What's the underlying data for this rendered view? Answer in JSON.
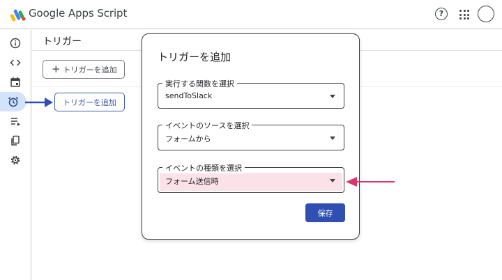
{
  "app": {
    "title": "Google Apps Script"
  },
  "header": {
    "help_glyph": "?",
    "icons": [
      "help-icon",
      "apps-grid-icon",
      "account-avatar"
    ]
  },
  "sidebar": {
    "items": [
      {
        "icon": "info-icon"
      },
      {
        "icon": "code-icon"
      },
      {
        "icon": "calendar-icon"
      },
      {
        "icon": "alarm-clock-icon",
        "active": true
      },
      {
        "icon": "playlist-icon"
      },
      {
        "icon": "copy-icon"
      },
      {
        "icon": "gear-icon"
      }
    ]
  },
  "page": {
    "title": "トリガー",
    "add_trigger_label": "トリガーを追加",
    "add_trigger_callout_label": "トリガーを追加"
  },
  "dialog": {
    "title": "トリガーを追加",
    "function_field": {
      "label": "実行する関数を選択",
      "value": "sendToSlack"
    },
    "source_field": {
      "label": "イベントのソースを選択",
      "value": "フォームから"
    },
    "event_type_field": {
      "label": "イベントの種類を選択",
      "value": "フォーム送信時"
    },
    "save_label": "保存"
  },
  "colors": {
    "accent_blue": "#2f4fb2",
    "callout_blue": "#3b5aa8",
    "highlight_pink": "#fbe1e8",
    "arrow_pink": "#e0336e",
    "active_nav_bg": "#d3e3fd"
  }
}
